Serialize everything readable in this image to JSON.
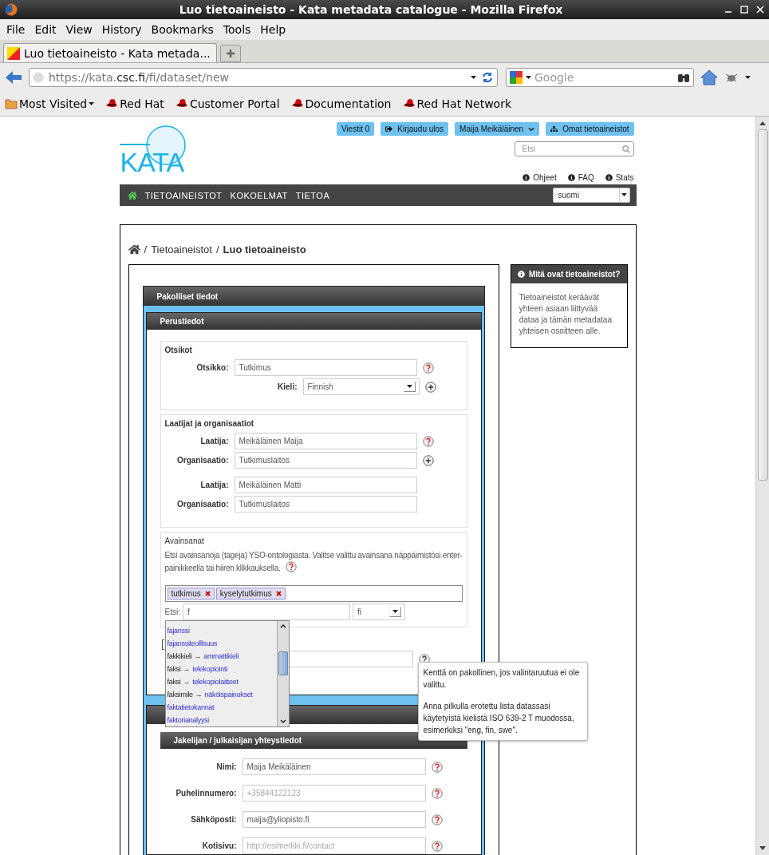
{
  "window": {
    "title": "Luo tietoaineisto - Kata metadata catalogue - Mozilla Firefox"
  },
  "menu": [
    "File",
    "Edit",
    "View",
    "History",
    "Bookmarks",
    "Tools",
    "Help"
  ],
  "tabs": [
    {
      "label": "Luo tietoaineisto - Kata metada...",
      "selected": true
    }
  ],
  "address": {
    "prefix": "https://kata.",
    "domain": "csc.fi",
    "path": "/fi/dataset/new"
  },
  "web_search": {
    "placeholder": "Google"
  },
  "bookmarks": [
    {
      "label": "Most Visited",
      "kind": "folder"
    },
    {
      "label": "Red Hat",
      "kind": "link"
    },
    {
      "label": "Customer Portal",
      "kind": "link"
    },
    {
      "label": "Documentation",
      "kind": "link"
    },
    {
      "label": "Red Hat Network",
      "kind": "link"
    }
  ],
  "site": {
    "logo": "KATA",
    "top_buttons": [
      {
        "label": "Viestit 0",
        "kind": "plain"
      },
      {
        "label": "Kirjaudu ulos",
        "kind": "logout"
      },
      {
        "label": "Maija Meikäläinen",
        "kind": "menu"
      },
      {
        "label": "Omat tietoaineistot",
        "kind": "datasets"
      }
    ],
    "search": {
      "placeholder": "Etsi"
    },
    "help_links": [
      "Ohjeet",
      "FAQ",
      "Stats"
    ],
    "nav": [
      "TIETOAINEISTOT",
      "KOKOELMAT",
      "TIETOA"
    ],
    "language": "suomi"
  },
  "breadcrumb": [
    {
      "separator": "/",
      "label": "Tietoaineistot",
      "current": false
    },
    {
      "separator": "/",
      "label": "Luo tietoaineisto",
      "current": true
    }
  ],
  "sidebar": {
    "title": "Mitä ovat tietoaineistot?",
    "text": "Tietoaineistot keräävät yhteen asiaan liittyvää dataa ja tämän metadataa yhteisen osoitteen alle."
  },
  "form": {
    "section": "Pakolliset tiedot",
    "panel": "Perustiedot",
    "fieldsets": [
      {
        "legend": "Otsikot",
        "groups": [
          [
            {
              "label": "Otsikko:",
              "value": "Tutkimus",
              "kind": "text",
              "help": true
            },
            {
              "label": "Kieli:",
              "value": "Finnish",
              "kind": "select",
              "add": true
            }
          ]
        ]
      },
      {
        "legend": "Laatijat ja organisaatiot",
        "groups": [
          [
            {
              "label": "Laatija:",
              "value": "Meikäläinen Maija",
              "kind": "text",
              "help": true
            },
            {
              "label": "Organisaatio:",
              "value": "Tutkimuslaitos",
              "kind": "text",
              "add": true
            }
          ],
          [
            {
              "label": "Laatija:",
              "value": "Meikäläinen Matti",
              "kind": "text"
            },
            {
              "label": "Organisaatio:",
              "value": "Tutkimuslaitos",
              "kind": "text"
            }
          ]
        ]
      }
    ],
    "keywords": {
      "legend": "Avainsanat",
      "description": "Etsi avainsanoja (tageja) YSO-ontologiasta. Valitse valittu avainsana näppäimistösi enter-painikkeella tai hiiren klikkauksella.",
      "tags": [
        "tutkimus",
        "kyselytutkimus"
      ],
      "search_label": "Etsi:",
      "search_value": "f",
      "language": "fi",
      "suggestions": [
        {
          "term": "fajanssi"
        },
        {
          "term": "fajanssiteollisuus"
        },
        {
          "term": "fakkikieli",
          "arrow": "→",
          "target": "ammattikieli"
        },
        {
          "term": "faksi",
          "arrow": "→",
          "target": "telekopiointi"
        },
        {
          "term": "faksi",
          "arrow": "→",
          "target": "telekopiolaitteet"
        },
        {
          "term": "faksimile",
          "arrow": "→",
          "target": "näköispainokset"
        },
        {
          "term": "faktatietokannat"
        },
        {
          "term": "faktorianalyysi"
        }
      ]
    },
    "language_field": {
      "tooltip": [
        "Kenttä on pakollinen, jos valintaruutua ei ole valittu.",
        "Anna pilkulla erotettu lista datassasi käytetyistä kielistä ISO 639-2 T muodossa, esimerkiksi \"eng, fin, swe\"."
      ]
    },
    "contact": {
      "title": "Jakelijan / julkaisijan yhteystiedot",
      "fields": [
        {
          "label": "Nimi:",
          "value": "Maija Meikäläinen"
        },
        {
          "label": "Puhelinnumero:",
          "placeholder": "+35844122123"
        },
        {
          "label": "Sähköposti:",
          "value": "maija@yliopisto.fi"
        },
        {
          "label": "Kotisivu:",
          "placeholder": "http://esimerkki.fi/contact"
        }
      ]
    }
  }
}
